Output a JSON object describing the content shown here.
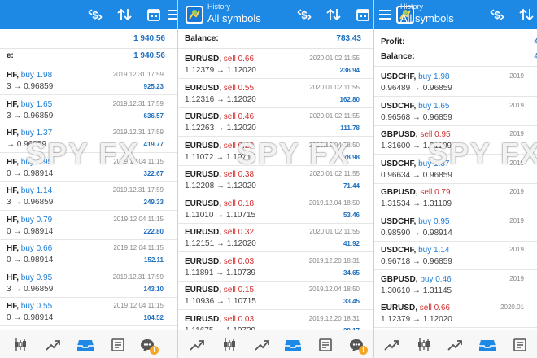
{
  "colors": {
    "accent": "#1e88e5",
    "buy": "#1e7cd6",
    "sell": "#d32f2f",
    "profit": "#1e6fbf"
  },
  "watermark": "SPY FX",
  "arrow": "→",
  "panels": [
    {
      "header": {
        "title_small": "",
        "title": ""
      },
      "summary": [
        {
          "label": "",
          "value": "1 940.56"
        },
        {
          "label": "e:",
          "value": "1 940.56"
        }
      ],
      "rows": [
        {
          "sym": "HF,",
          "side": "buy 1.98",
          "type": "buy",
          "prices": "3 → 0.96859",
          "date": "2019.12.31 17:59",
          "pl": "925.23"
        },
        {
          "sym": "HF,",
          "side": "buy 1.65",
          "type": "buy",
          "prices": "3 → 0.96859",
          "date": "2019.12.31 17:59",
          "pl": "636.57"
        },
        {
          "sym": "HF,",
          "side": "buy 1.37",
          "type": "buy",
          "prices": "→ 0.96859",
          "date": "2019.12.31 17:59",
          "pl": "419.77"
        },
        {
          "sym": "HF,",
          "side": "buy 0.95",
          "type": "buy",
          "prices": "0 → 0.98914",
          "date": "2019.12.04 11:15",
          "pl": "322.67"
        },
        {
          "sym": "HF,",
          "side": "buy 1.14",
          "type": "buy",
          "prices": "3 → 0.96859",
          "date": "2019.12.31 17:59",
          "pl": "249.33"
        },
        {
          "sym": "HF,",
          "side": "buy 0.79",
          "type": "buy",
          "prices": "0 → 0.98914",
          "date": "2019.12.04 11:15",
          "pl": "222.80"
        },
        {
          "sym": "HF,",
          "side": "buy 0.66",
          "type": "buy",
          "prices": "0 → 0.98914",
          "date": "2019.12.04 11:15",
          "pl": "152.11"
        },
        {
          "sym": "HF,",
          "side": "buy 0.95",
          "type": "buy",
          "prices": "3 → 0.96859",
          "date": "2019.12.31 17:59",
          "pl": "143.10"
        },
        {
          "sym": "HF,",
          "side": "buy 0.55",
          "type": "buy",
          "prices": "0 → 0.98914",
          "date": "2019.12.04 11:15",
          "pl": "104.52"
        }
      ]
    },
    {
      "header": {
        "title_small": "History",
        "title": "All symbols"
      },
      "summary": [
        {
          "label": "Balance:",
          "value": "783.43"
        }
      ],
      "rows": [
        {
          "sym": "EURUSD,",
          "side": "sell 0.66",
          "type": "sell",
          "prices": "1.12379 → 1.12020",
          "date": "2020.01.02 11:55",
          "pl": "236.94"
        },
        {
          "sym": "EURUSD,",
          "side": "sell 0.55",
          "type": "sell",
          "prices": "1.12316 → 1.12020",
          "date": "2020.01.02 11:55",
          "pl": "162.80"
        },
        {
          "sym": "EURUSD,",
          "side": "sell 0.46",
          "type": "sell",
          "prices": "1.12263 → 1.12020",
          "date": "2020.01.02 11:55",
          "pl": "111.78"
        },
        {
          "sym": "EURUSD,",
          "side": "sell 0.22",
          "type": "sell",
          "prices": "1.11072 → 1.10715",
          "date": "2019.12.04 18:50",
          "pl": "78.98"
        },
        {
          "sym": "EURUSD,",
          "side": "sell 0.38",
          "type": "sell",
          "prices": "1.12208 → 1.12020",
          "date": "2020.01.02 11:55",
          "pl": "71.44"
        },
        {
          "sym": "EURUSD,",
          "side": "sell 0.18",
          "type": "sell",
          "prices": "1.11010 → 1.10715",
          "date": "2019.12.04 18:50",
          "pl": "53.46"
        },
        {
          "sym": "EURUSD,",
          "side": "sell 0.32",
          "type": "sell",
          "prices": "1.12151 → 1.12020",
          "date": "2020.01.02 11:55",
          "pl": "41.92"
        },
        {
          "sym": "EURUSD,",
          "side": "sell 0.03",
          "type": "sell",
          "prices": "1.11891 → 1.10739",
          "date": "2019.12.20 18:31",
          "pl": "34.65"
        },
        {
          "sym": "EURUSD,",
          "side": "sell 0.15",
          "type": "sell",
          "prices": "1.10936 → 1.10715",
          "date": "2019.12.04 18:50",
          "pl": "33.45"
        },
        {
          "sym": "EURUSD,",
          "side": "sell 0.03",
          "type": "sell",
          "prices": "1.11675 → 1.10739",
          "date": "2019.12.20 18:31",
          "pl": "28.17"
        }
      ]
    },
    {
      "header": {
        "title_small": "History",
        "title": "All symbols"
      },
      "summary": [
        {
          "label": "Profit:",
          "value": "4"
        },
        {
          "label": "Balance:",
          "value": "4"
        }
      ],
      "rows": [
        {
          "sym": "USDCHF,",
          "side": "buy 1.98",
          "type": "buy",
          "prices": "0.96489 → 0.96859",
          "date": "2019",
          "pl": ""
        },
        {
          "sym": "USDCHF,",
          "side": "buy 1.65",
          "type": "buy",
          "prices": "0.96568 → 0.96859",
          "date": "2019",
          "pl": ""
        },
        {
          "sym": "GBPUSD,",
          "side": "sell 0.95",
          "type": "sell",
          "prices": "1.31600 → 1.31109",
          "date": "2019",
          "pl": ""
        },
        {
          "sym": "USDCHF,",
          "side": "buy 1.37",
          "type": "buy",
          "prices": "0.96634 → 0.96859",
          "date": "2019",
          "pl": ""
        },
        {
          "sym": "GBPUSD,",
          "side": "sell 0.79",
          "type": "sell",
          "prices": "1.31534 → 1.31109",
          "date": "2019",
          "pl": ""
        },
        {
          "sym": "USDCHF,",
          "side": "buy 0.95",
          "type": "buy",
          "prices": "0.98590 → 0.98914",
          "date": "2019",
          "pl": ""
        },
        {
          "sym": "USDCHF,",
          "side": "buy 1.14",
          "type": "buy",
          "prices": "0.96718 → 0.96859",
          "date": "2019",
          "pl": ""
        },
        {
          "sym": "GBPUSD,",
          "side": "buy 0.46",
          "type": "buy",
          "prices": "1.30610 → 1.31145",
          "date": "2019",
          "pl": ""
        },
        {
          "sym": "EURUSD,",
          "side": "sell 0.66",
          "type": "sell",
          "prices": "1.12379 → 1.12020",
          "date": "2020.01",
          "pl": ""
        }
      ]
    }
  ],
  "nav_badge": "!"
}
